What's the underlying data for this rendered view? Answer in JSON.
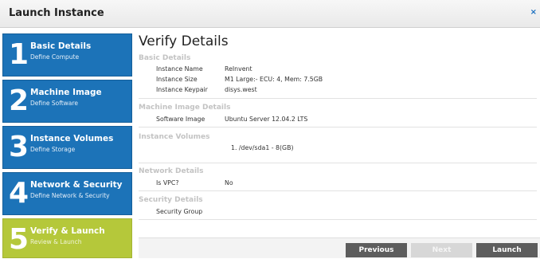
{
  "window": {
    "title": "Launch Instance",
    "close_glyph": "×"
  },
  "steps": [
    {
      "number": "1",
      "label": "Basic Details",
      "sub": "Define Compute"
    },
    {
      "number": "2",
      "label": "Machine Image",
      "sub": "Define Software"
    },
    {
      "number": "3",
      "label": "Instance Volumes",
      "sub": "Define Storage"
    },
    {
      "number": "4",
      "label": "Network & Security",
      "sub": "Define Network & Security"
    },
    {
      "number": "5",
      "label": "Verify & Launch",
      "sub": "Review & Launch"
    }
  ],
  "verify": {
    "heading": "Verify Details",
    "basic": {
      "title": "Basic Details",
      "rows": [
        {
          "key": "Instance Name",
          "value": "ReInvent"
        },
        {
          "key": "Instance Size",
          "value": "M1 Large:- ECU: 4, Mem: 7.5GB"
        },
        {
          "key": "Instance Keypair",
          "value": "disys.west"
        }
      ]
    },
    "image": {
      "title": "Machine Image Details",
      "rows": [
        {
          "key": "Software Image",
          "value": "Ubuntu Server 12.04.2 LTS"
        }
      ]
    },
    "volumes": {
      "title": "Instance Volumes",
      "items": [
        "1.  /dev/sda1 - 8(GB)"
      ]
    },
    "network": {
      "title": "Network Details",
      "rows": [
        {
          "key": "Is VPC?",
          "value": "No"
        }
      ]
    },
    "security": {
      "title": "Security Details",
      "rows": [
        {
          "key": "Security Group",
          "value": ""
        }
      ]
    }
  },
  "buttons": {
    "previous": "Previous",
    "next": "Next",
    "launch": "Launch"
  },
  "colors": {
    "step_blue": "#1c73b8",
    "step_active": "#b5c83a",
    "button_dark": "#5d5d5d"
  }
}
